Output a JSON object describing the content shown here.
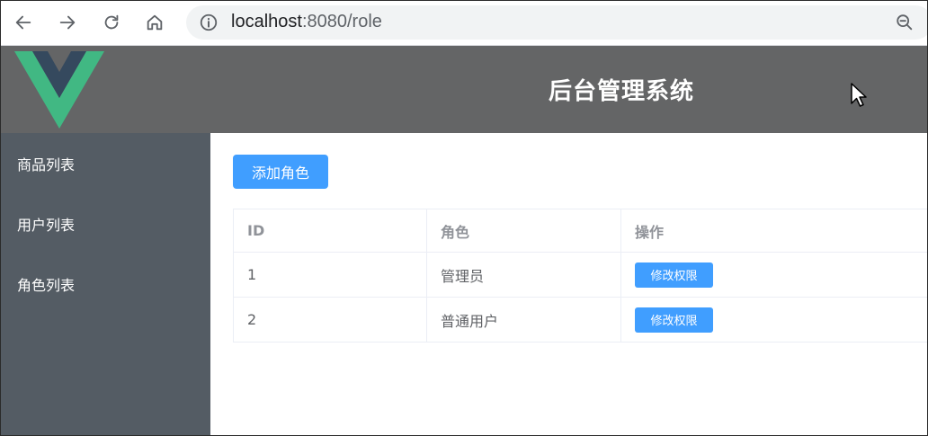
{
  "browser": {
    "url_host": "localhost",
    "url_rest": ":8080/role"
  },
  "header": {
    "title": "后台管理系统"
  },
  "sidebar": {
    "items": [
      {
        "label": "商品列表"
      },
      {
        "label": "用户列表"
      },
      {
        "label": "角色列表"
      }
    ]
  },
  "main": {
    "add_button_label": "添加角色",
    "table": {
      "headers": [
        "ID",
        "角色",
        "操作"
      ],
      "rows": [
        {
          "id": "1",
          "role": "管理员",
          "action": "修改权限"
        },
        {
          "id": "2",
          "role": "普通用户",
          "action": "修改权限"
        }
      ]
    }
  },
  "colors": {
    "primary": "#409eff",
    "header_bg": "#646566",
    "sidebar_bg": "#545c64",
    "vue_green": "#41b883",
    "vue_dark": "#35495e"
  }
}
